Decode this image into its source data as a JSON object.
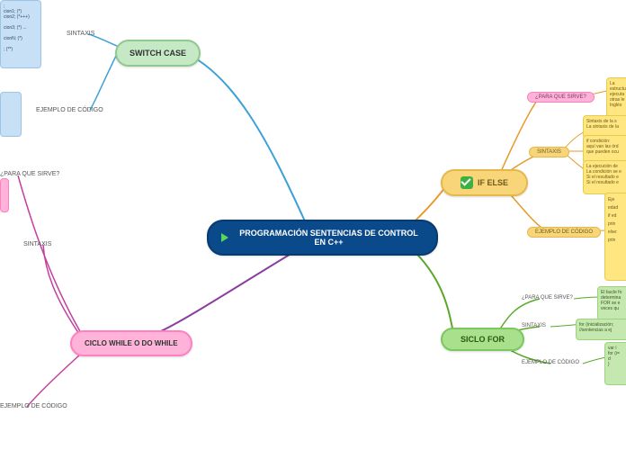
{
  "center": "PROGRAMACIÓN SENTENCIAS DE CONTROL EN C++",
  "switch": {
    "title": "SWITCH CASE",
    "syntax_label": "SINTAXIS",
    "example_label": "EJEMPLO DE CÓDIGO"
  },
  "while": {
    "title": "CICLO WHILE O DO WHILE",
    "purpose_label": "¿PARA QUE SIRVE?",
    "syntax_label": "SINTAXIS",
    "example_label": "EJEMPLO DE CÓDIGO"
  },
  "ifelse": {
    "title": "IF ELSE",
    "purpose_label": "¿PARA QUE SIRVE?",
    "syntax_label": "SINTAXIS",
    "example_label": "EJEMPLO DE CÓDIGO",
    "purpose_text": "La estructura\nejecuta\notras le\nInglés",
    "syntax_text1": "Sintaxis de la s\nLa sintaxis de la",
    "syntax_text2": "if condición:\naquí van las órd\nque pueden ocu",
    "syntax_text3": "La ejecución de\nLa condición se e\nSi el resultado e\nSi el resultado e",
    "example_text": "Eje\nedad\nif ed\nprin\nelse:\nprin"
  },
  "for": {
    "title": "SICLO FOR",
    "purpose_label": "¿PARA QUE SIRVE?",
    "syntax_label": "SINTAXIS",
    "example_label": "EJEMPLO DE CÓDIGO",
    "purpose_text": "El bucle fo\ndetermina\nFOR se e\nveces qu",
    "syntax_text": "for (inicialización;\n//sentencias a ej",
    "example_text": "var i\nfor (i=\n    d\n}"
  },
  "switch_code": ";\ncion1; (*)\ncion2; (*+++)\n\ncion3; (*)  ...\n\ncionN; (*)\n\n; (**)"
}
